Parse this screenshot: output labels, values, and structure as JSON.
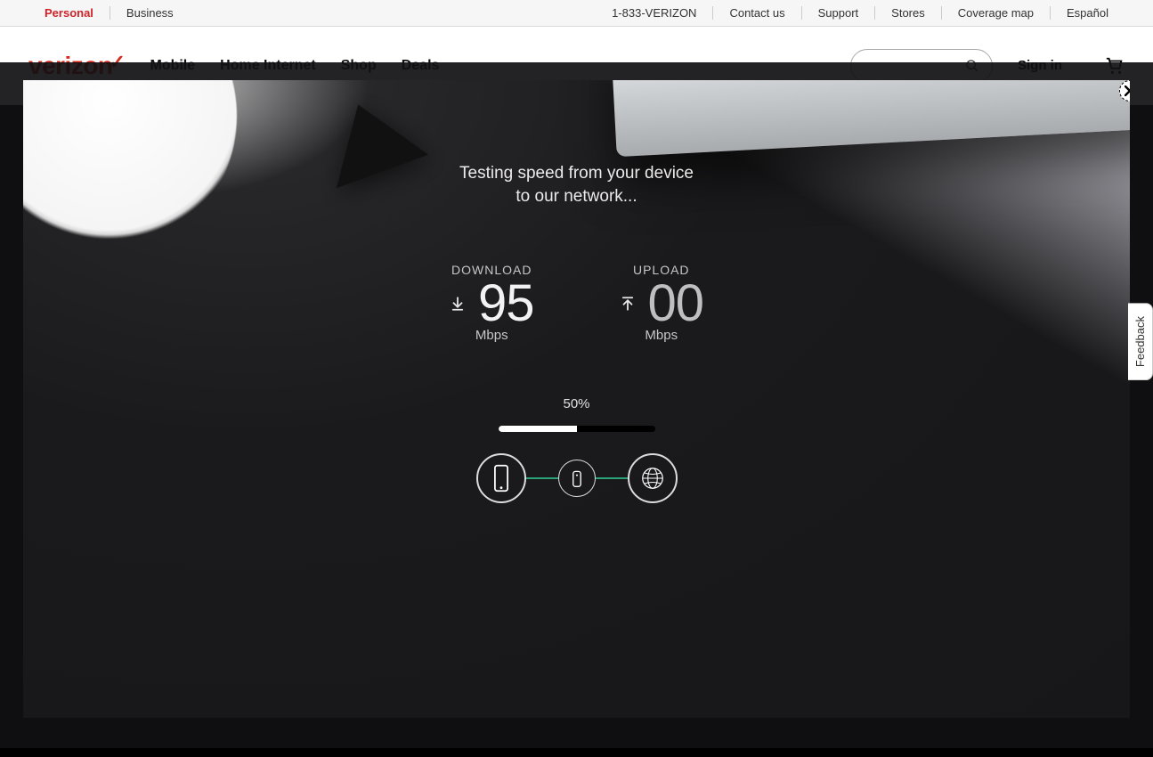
{
  "top": {
    "personal": "Personal",
    "business": "Business",
    "phone": "1-833-VERIZON",
    "contact": "Contact us",
    "support": "Support",
    "stores": "Stores",
    "coverage": "Coverage map",
    "espanol": "Español"
  },
  "header": {
    "logo": "verizon",
    "nav": {
      "mobile": "Mobile",
      "home": "Home Internet",
      "shop": "Shop",
      "deals": "Deals"
    },
    "signin": "Sign in"
  },
  "modal": {
    "status_l1": "Testing speed from your device",
    "status_l2": "to our network...",
    "download_label": "DOWNLOAD",
    "download_value": "95",
    "download_unit": "Mbps",
    "upload_label": "UPLOAD",
    "upload_value": "00",
    "upload_unit": "Mbps",
    "percent_text": "50%",
    "progress_pct": 50
  },
  "feedback": "Feedback"
}
